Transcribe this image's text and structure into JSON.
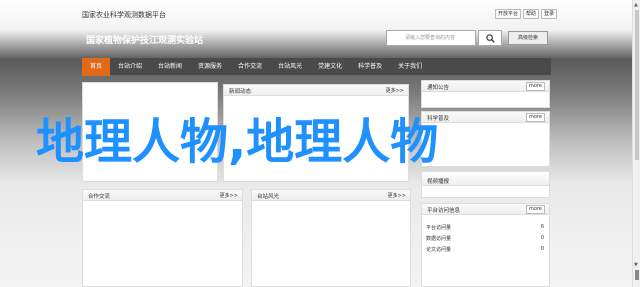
{
  "header": {
    "top_text": "国家农业科学观测数据平台",
    "links": [
      "开放平台",
      "帮助",
      "登录"
    ],
    "site_title": "国家植物保护技江观测实验站",
    "search_placeholder": "请输入您要查询的内容",
    "advanced_search": "高级检索"
  },
  "nav": {
    "items": [
      "首页",
      "台站介绍",
      "台站新闻",
      "资源服务",
      "合作交流",
      "台站风光",
      "党建文化",
      "科学普及",
      "关于我们"
    ],
    "active_index": 0
  },
  "panels": {
    "news": {
      "title": "新闻动态",
      "more": "更多>>"
    },
    "notice": {
      "title": "通知公告",
      "more": "more"
    },
    "science": {
      "title": "科学普及",
      "more": "more"
    },
    "video": {
      "title": "视频播报"
    },
    "coop": {
      "title": "合作交流",
      "more": "更多>>"
    },
    "scenery": {
      "title": "台站风光",
      "more": "更多>>"
    },
    "stats": {
      "title": "平台访问信息",
      "more": "more",
      "rows": [
        {
          "label": "平台访问量",
          "value": "6"
        },
        {
          "label": "数据访问量",
          "value": "0"
        },
        {
          "label": "论文访问量",
          "value": "0"
        }
      ]
    }
  },
  "overlay_text": "地理人物,地理人物",
  "colors": {
    "nav_active": "#e06a1b",
    "overlay": "#1e90ff"
  }
}
